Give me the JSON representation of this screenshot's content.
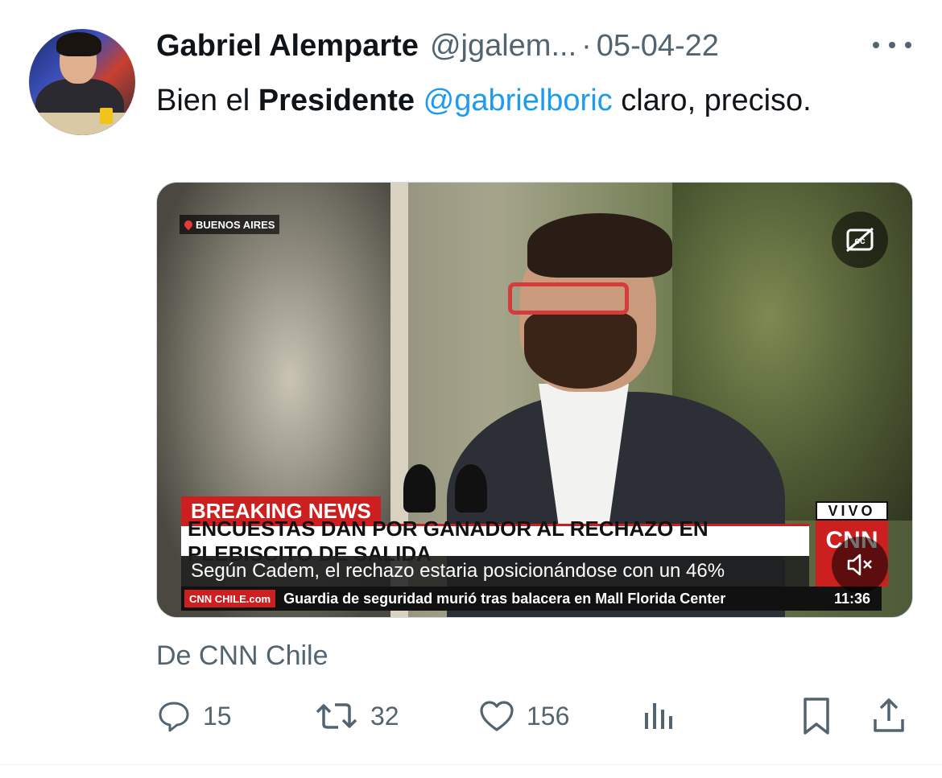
{
  "author": {
    "name": "Gabriel Alemparte",
    "handle": "@jgalem...",
    "separator": "·",
    "date": "05-04-22"
  },
  "tweet": {
    "text_before": "Bien el ",
    "bold": "Presidente",
    "mention": "@gabrielboric",
    "text_after": " claro, preciso."
  },
  "media": {
    "location": "BUENOS AIRES",
    "breaking_label": "BREAKING NEWS",
    "headline": "ENCUESTAS DAN POR GANADOR AL RECHAZO EN PLEBISCITO DE SALIDA",
    "subline": "Según Cadem, el rechazo estaria posicionándose con un 46%",
    "ticker_logo": "CNN CHILE.com",
    "ticker_text": "Guardia de seguridad murió tras balacera en Mall Florida Center",
    "time": "11:36",
    "live_label": "VIVO",
    "channel_logo": "CNN"
  },
  "source": "De CNN Chile",
  "actions": {
    "replies": "15",
    "retweets": "32",
    "likes": "156"
  },
  "colors": {
    "accent": "#1d9bf0",
    "secondary_text": "#536471",
    "breaking_red": "#cc1f1f"
  },
  "icons": [
    "more-icon",
    "location-pin-icon",
    "closed-captions-icon",
    "mute-icon",
    "reply-icon",
    "retweet-icon",
    "like-icon",
    "views-icon",
    "bookmark-icon",
    "share-icon"
  ]
}
